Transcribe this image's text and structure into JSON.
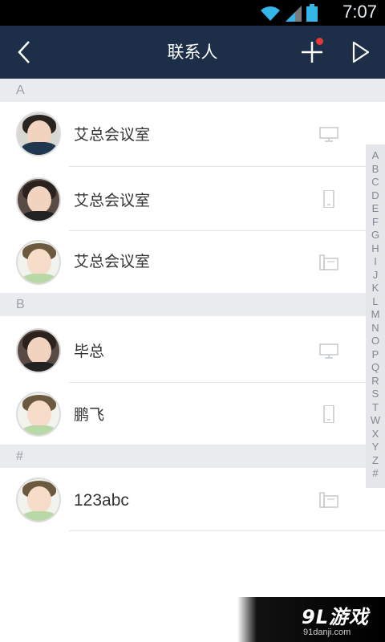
{
  "status_bar": {
    "time": "7:07",
    "icons": [
      "wifi-icon",
      "signal-icon",
      "battery-icon"
    ]
  },
  "header": {
    "title": "联系人",
    "back_icon": "chevron-left-icon",
    "add_icon": "plus-icon",
    "forward_icon": "play-triangle-icon",
    "has_notification": true
  },
  "sections": [
    {
      "letter": "A",
      "contacts": [
        {
          "name": "艾总会议室",
          "avatar": "avatar-girl",
          "device": "desktop-monitor-icon"
        },
        {
          "name": "艾总会议室",
          "avatar": "avatar-boy",
          "device": "mobile-phone-icon"
        },
        {
          "name": "艾总会议室",
          "avatar": "avatar-kid",
          "device": "desk-phone-icon"
        }
      ]
    },
    {
      "letter": "B",
      "contacts": [
        {
          "name": "毕总",
          "avatar": "avatar-boy",
          "device": "desktop-monitor-icon"
        },
        {
          "name": "鹏飞",
          "avatar": "avatar-kid",
          "device": "mobile-phone-icon"
        }
      ]
    },
    {
      "letter": "#",
      "contacts": [
        {
          "name": "123abc",
          "avatar": "avatar-kid",
          "device": "desk-phone-icon"
        }
      ]
    }
  ],
  "index_letters": [
    "A",
    "B",
    "C",
    "D",
    "E",
    "F",
    "G",
    "H",
    "I",
    "J",
    "K",
    "L",
    "M",
    "N",
    "O",
    "P",
    "Q",
    "R",
    "S",
    "T",
    "W",
    "X",
    "Y",
    "Z",
    "#"
  ],
  "watermark": {
    "logo": "9L游戏",
    "url": "91danji.com"
  },
  "colors": {
    "header_bg": "#1d2f48",
    "section_bg": "#e9ebef",
    "notification_dot": "#e53935"
  }
}
